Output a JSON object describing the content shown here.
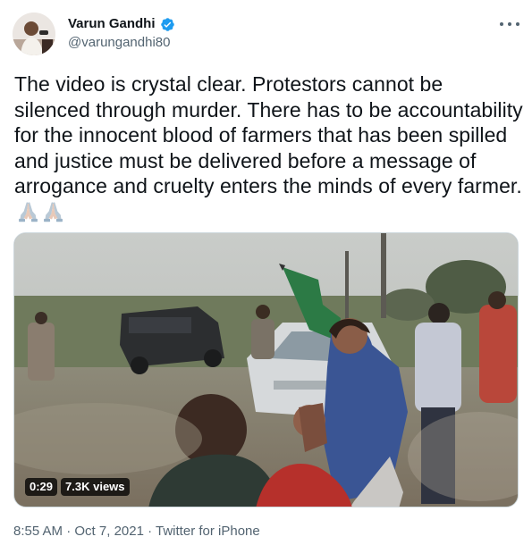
{
  "author": {
    "display_name": "Varun Gandhi",
    "handle": "@varungandhi80",
    "verified": true
  },
  "tweet": {
    "text": "The video is crystal clear. Protestors cannot be silenced through murder. There has to be accountability for the innocent blood of farmers that has been spilled and justice must be delivered before a message of arrogance and cruelty enters the minds of every farmer.",
    "emoji": [
      "folded-hands",
      "folded-hands"
    ]
  },
  "media": {
    "type": "video",
    "duration": "0:29",
    "views": "7.3K views"
  },
  "meta": {
    "time": "8:55 AM",
    "separator1": " · ",
    "date": "Oct 7, 2021",
    "separator2": " · ",
    "source": "Twitter for iPhone"
  },
  "colors": {
    "verified_blue": "#1d9bf0",
    "text_primary": "#0f1419",
    "text_secondary": "#536471",
    "border": "#cfd9de"
  }
}
